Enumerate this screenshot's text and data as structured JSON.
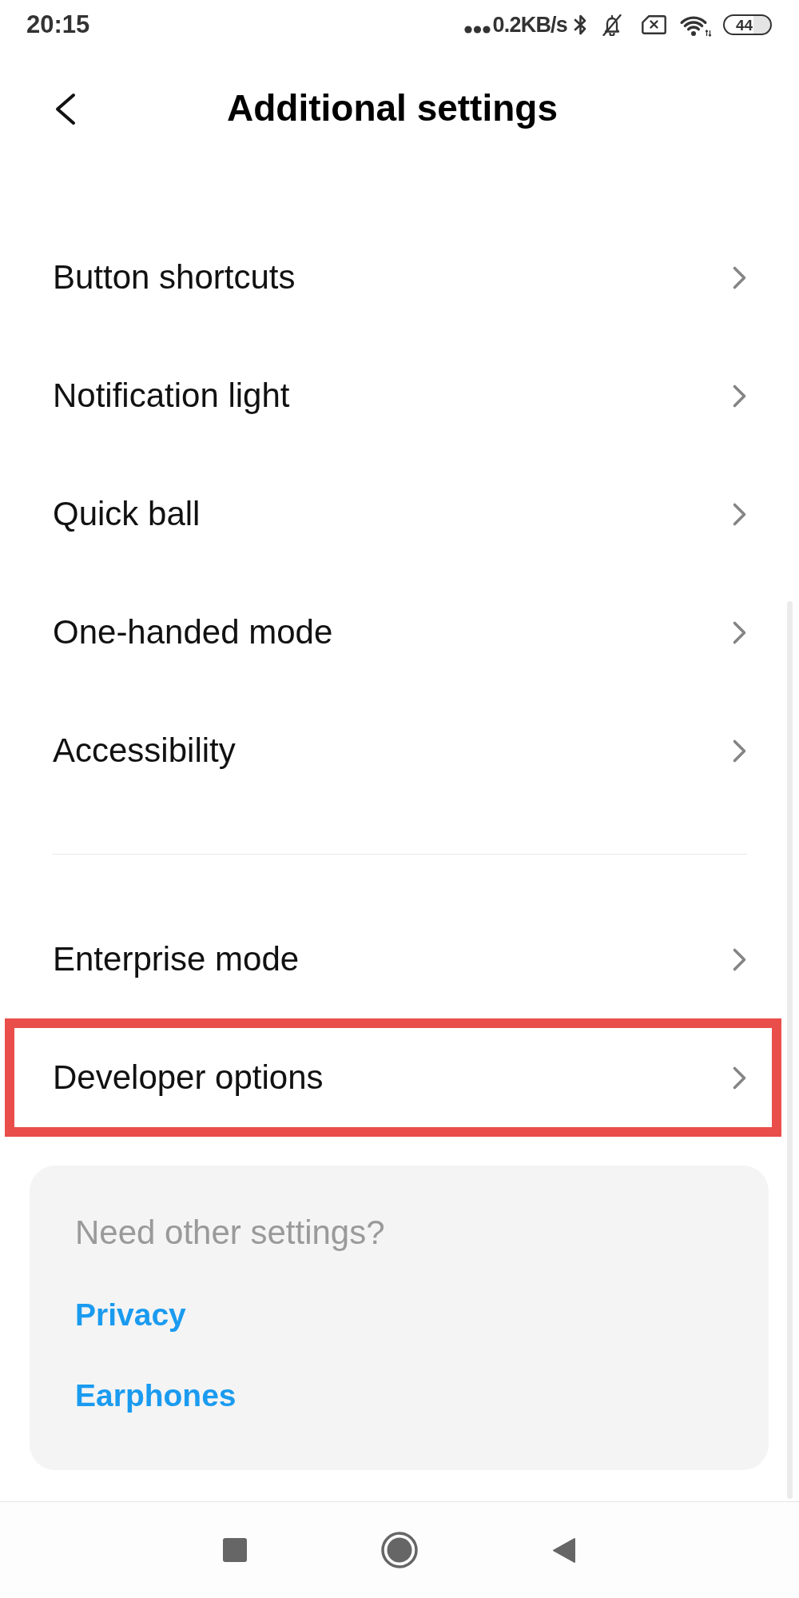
{
  "status_bar": {
    "time": "20:15",
    "network_speed": "0.2KB/s",
    "battery": "44"
  },
  "header": {
    "title": "Additional settings"
  },
  "groups": [
    {
      "items": [
        {
          "label": "Button shortcuts",
          "highlighted": false
        },
        {
          "label": "Notification light",
          "highlighted": false
        },
        {
          "label": "Quick ball",
          "highlighted": false
        },
        {
          "label": "One-handed mode",
          "highlighted": false
        },
        {
          "label": "Accessibility",
          "highlighted": false
        }
      ]
    },
    {
      "items": [
        {
          "label": "Enterprise mode",
          "highlighted": false
        },
        {
          "label": "Developer options",
          "highlighted": true
        }
      ]
    }
  ],
  "suggestions": {
    "title": "Need other settings?",
    "links": [
      "Privacy",
      "Earphones"
    ]
  }
}
